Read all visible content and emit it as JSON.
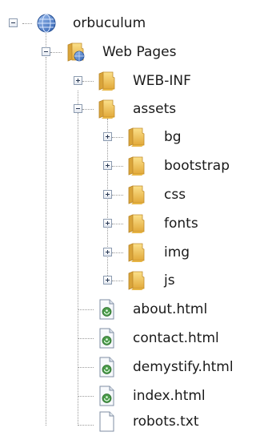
{
  "tree": {
    "root": {
      "label": "orbuculum",
      "icon": "globe-icon",
      "expanded": true
    },
    "web_pages": {
      "label": "Web Pages",
      "icon": "web-folder-icon",
      "expanded": true
    },
    "web_inf": {
      "label": "WEB-INF",
      "icon": "folder-icon",
      "expanded": false
    },
    "assets": {
      "label": "assets",
      "icon": "folder-icon",
      "expanded": true,
      "children": [
        {
          "label": "bg",
          "icon": "folder-icon",
          "expanded": false
        },
        {
          "label": "bootstrap",
          "icon": "folder-icon",
          "expanded": false
        },
        {
          "label": "css",
          "icon": "folder-icon",
          "expanded": false
        },
        {
          "label": "fonts",
          "icon": "folder-icon",
          "expanded": false
        },
        {
          "label": "img",
          "icon": "folder-icon",
          "expanded": false
        },
        {
          "label": "js",
          "icon": "folder-icon",
          "expanded": false
        }
      ]
    },
    "files": [
      {
        "label": "about.html",
        "icon": "html-file-icon"
      },
      {
        "label": "contact.html",
        "icon": "html-file-icon"
      },
      {
        "label": "demystify.html",
        "icon": "html-file-icon"
      },
      {
        "label": "index.html",
        "icon": "html-file-icon"
      },
      {
        "label": "robots.txt",
        "icon": "text-file-icon"
      }
    ]
  },
  "colors": {
    "folder": "#f0c24a",
    "folder_dark": "#c9962a",
    "globe": "#3f6fbf",
    "file_accent": "#3a8a3a"
  }
}
